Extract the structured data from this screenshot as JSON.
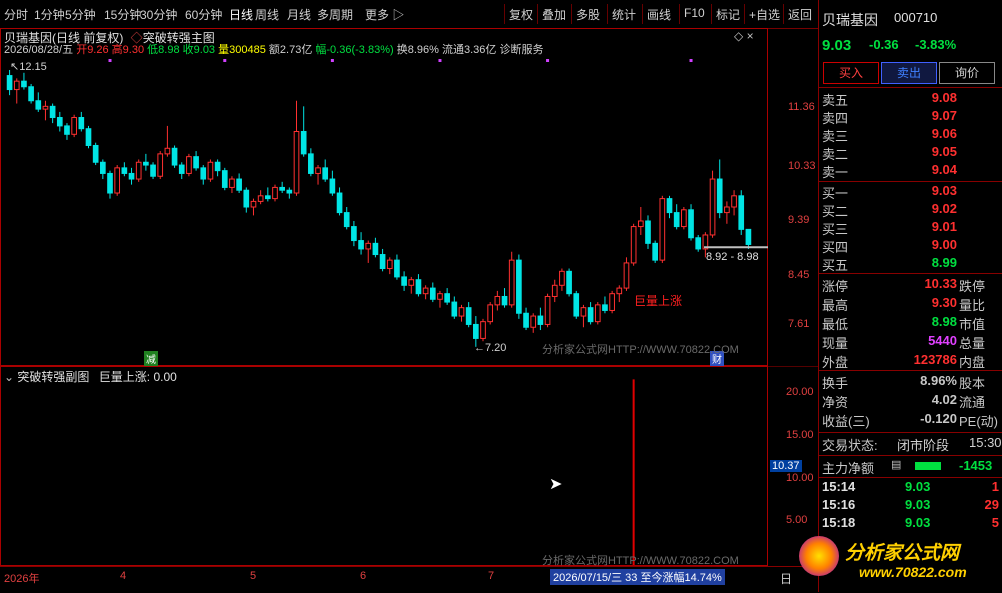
{
  "toolbar": {
    "items": [
      "分时",
      "1分钟",
      "5分钟",
      "15分钟",
      "30分钟",
      "60分钟",
      "日线",
      "周线",
      "月线",
      "多周期",
      "更多 ▷"
    ],
    "right_items": [
      "复权",
      "叠加",
      "多股",
      "统计",
      "画线",
      "F10",
      "标记",
      "+自选",
      "返回"
    ]
  },
  "main": {
    "title": "贝瑞基因(日线 前复权)",
    "indicator": "突破转强主图",
    "info": {
      "date": "2026/08/28/五",
      "open_label": "开",
      "open": "9.26",
      "high_label": "高",
      "high": "9.30",
      "low_label": "低",
      "low": "8.98",
      "close_label": "收",
      "close": "9.03",
      "volume_label": "量",
      "volume": "300485",
      "amount_label": "额",
      "amount": "2.73亿",
      "change_label": "幅",
      "change": "-0.36(-3.83%)",
      "turnover_label": "换",
      "turnover": "8.96%",
      "float_label": "流通",
      "float": "3.36亿",
      "service": "诊断服务"
    },
    "y_axis": [
      "11.36",
      "10.33",
      "9.39",
      "8.45",
      "7.61"
    ],
    "annotations": {
      "high_mark": "12.15",
      "low_mark": "←7.20",
      "range_label": "8.92 - 8.98",
      "signal_label": "巨量上涨",
      "minus_badge": "减",
      "fin_badge": "财",
      "site_text": "分析家公式网HTTP://WWW.70822.COM"
    }
  },
  "sub": {
    "title": "突破转强副图",
    "signal_label": "巨量上涨:",
    "signal_value": "0.00",
    "y_axis": [
      "20.00",
      "15.00",
      "10.00",
      "5.00"
    ],
    "cursor_value": "10.37"
  },
  "bottom": {
    "months": [
      "2026年",
      "4",
      "5",
      "6",
      "7"
    ],
    "range_info": "2026/07/15/三  33 至今涨幅14.74%",
    "right_label": "日"
  },
  "panel": {
    "name": "贝瑞基因",
    "code": "000710",
    "price": "9.03",
    "change": "-0.36",
    "change_pct": "-3.83%",
    "buttons": [
      "买入",
      "卖出",
      "询价"
    ],
    "sells": [
      {
        "label": "卖五",
        "price": "9.08"
      },
      {
        "label": "卖四",
        "price": "9.07"
      },
      {
        "label": "卖三",
        "price": "9.06"
      },
      {
        "label": "卖二",
        "price": "9.05"
      },
      {
        "label": "卖一",
        "price": "9.04"
      }
    ],
    "buys": [
      {
        "label": "买一",
        "price": "9.03"
      },
      {
        "label": "买二",
        "price": "9.02"
      },
      {
        "label": "买三",
        "price": "9.01"
      },
      {
        "label": "买四",
        "price": "9.00"
      },
      {
        "label": "买五",
        "price": "8.99"
      }
    ],
    "stats": [
      {
        "label": "涨停",
        "value": "10.33",
        "cls": "up",
        "right": "跌停"
      },
      {
        "label": "最高",
        "value": "9.30",
        "cls": "up",
        "right": "量比"
      },
      {
        "label": "最低",
        "value": "8.98",
        "cls": "down",
        "right": "市值"
      },
      {
        "label": "现量",
        "value": "5440",
        "cls": "purple",
        "right": "总量"
      },
      {
        "label": "外盘",
        "value": "123786",
        "cls": "up",
        "right": "内盘"
      }
    ],
    "stats2": [
      {
        "label": "换手",
        "value": "8.96%",
        "cls": "flat",
        "right": "股本"
      },
      {
        "label": "净资",
        "value": "4.02",
        "cls": "flat",
        "right": "流通"
      },
      {
        "label": "收益(三)",
        "value": "-0.120",
        "cls": "flat",
        "right": "PE(动)"
      }
    ],
    "trade_status_label": "交易状态:",
    "trade_status": "闭市阶段",
    "trade_time": "15:30",
    "main_flow_label": "主力净额",
    "main_flow_value": "-1453",
    "ticks": [
      {
        "time": "15:14",
        "price": "9.03",
        "vol": "1"
      },
      {
        "time": "15:16",
        "price": "9.03",
        "vol": "29"
      },
      {
        "time": "15:18",
        "price": "9.03",
        "vol": "5"
      }
    ],
    "logo_text": "分析家公式网",
    "logo_url": "www.70822.com"
  },
  "chart_data": {
    "type": "candlestick",
    "ylim": [
      7.0,
      12.4
    ],
    "candles": [
      [
        12.05,
        12.15,
        11.7,
        11.8
      ],
      [
        11.8,
        12.0,
        11.55,
        11.95
      ],
      [
        11.95,
        12.1,
        11.8,
        11.85
      ],
      [
        11.85,
        11.9,
        11.55,
        11.6
      ],
      [
        11.6,
        11.75,
        11.4,
        11.45
      ],
      [
        11.45,
        11.6,
        11.25,
        11.5
      ],
      [
        11.5,
        11.55,
        11.2,
        11.3
      ],
      [
        11.3,
        11.4,
        11.05,
        11.15
      ],
      [
        11.15,
        11.2,
        10.9,
        11.0
      ],
      [
        11.0,
        11.35,
        10.95,
        11.3
      ],
      [
        11.3,
        11.4,
        11.05,
        11.1
      ],
      [
        11.1,
        11.15,
        10.75,
        10.8
      ],
      [
        10.8,
        10.85,
        10.45,
        10.5
      ],
      [
        10.5,
        10.55,
        10.2,
        10.3
      ],
      [
        10.3,
        10.35,
        9.85,
        9.95
      ],
      [
        9.95,
        10.45,
        9.9,
        10.4
      ],
      [
        10.4,
        10.5,
        10.25,
        10.3
      ],
      [
        10.3,
        10.4,
        10.1,
        10.2
      ],
      [
        10.2,
        10.55,
        10.15,
        10.5
      ],
      [
        10.5,
        10.65,
        10.35,
        10.45
      ],
      [
        10.45,
        10.5,
        10.2,
        10.25
      ],
      [
        10.25,
        10.7,
        10.2,
        10.65
      ],
      [
        10.65,
        11.15,
        10.6,
        10.75
      ],
      [
        10.75,
        10.8,
        10.4,
        10.45
      ],
      [
        10.45,
        10.5,
        10.2,
        10.3
      ],
      [
        10.3,
        10.65,
        10.25,
        10.6
      ],
      [
        10.6,
        10.7,
        10.35,
        10.4
      ],
      [
        10.4,
        10.45,
        10.1,
        10.2
      ],
      [
        10.2,
        10.55,
        10.15,
        10.5
      ],
      [
        10.5,
        10.55,
        10.25,
        10.35
      ],
      [
        10.35,
        10.4,
        10.0,
        10.05
      ],
      [
        10.05,
        10.25,
        9.95,
        10.2
      ],
      [
        10.2,
        10.3,
        9.95,
        10.0
      ],
      [
        10.0,
        10.05,
        9.6,
        9.7
      ],
      [
        9.7,
        9.85,
        9.55,
        9.8
      ],
      [
        9.8,
        10.0,
        9.75,
        9.9
      ],
      [
        9.9,
        10.05,
        9.8,
        9.85
      ],
      [
        9.85,
        10.1,
        9.8,
        10.05
      ],
      [
        10.05,
        10.15,
        9.95,
        10.0
      ],
      [
        10.0,
        10.05,
        9.85,
        9.95
      ],
      [
        9.95,
        11.6,
        9.9,
        11.05
      ],
      [
        11.05,
        11.5,
        10.6,
        10.65
      ],
      [
        10.65,
        10.75,
        10.25,
        10.3
      ],
      [
        10.3,
        10.45,
        10.1,
        10.4
      ],
      [
        10.4,
        10.55,
        10.15,
        10.2
      ],
      [
        10.2,
        10.35,
        9.9,
        9.95
      ],
      [
        9.95,
        10.05,
        9.55,
        9.6
      ],
      [
        9.6,
        9.7,
        9.3,
        9.35
      ],
      [
        9.35,
        9.45,
        9.0,
        9.1
      ],
      [
        9.1,
        9.25,
        8.85,
        8.95
      ],
      [
        8.95,
        9.1,
        8.7,
        9.05
      ],
      [
        9.05,
        9.15,
        8.8,
        8.85
      ],
      [
        8.85,
        8.95,
        8.55,
        8.6
      ],
      [
        8.6,
        8.8,
        8.5,
        8.75
      ],
      [
        8.75,
        8.85,
        8.4,
        8.45
      ],
      [
        8.45,
        8.55,
        8.2,
        8.3
      ],
      [
        8.3,
        8.45,
        8.15,
        8.4
      ],
      [
        8.4,
        8.5,
        8.1,
        8.15
      ],
      [
        8.15,
        8.3,
        8.05,
        8.25
      ],
      [
        8.25,
        8.35,
        8.0,
        8.05
      ],
      [
        8.05,
        8.2,
        7.9,
        8.15
      ],
      [
        8.15,
        8.25,
        7.95,
        8.0
      ],
      [
        8.0,
        8.1,
        7.7,
        7.75
      ],
      [
        7.75,
        7.95,
        7.65,
        7.9
      ],
      [
        7.9,
        8.0,
        7.55,
        7.6
      ],
      [
        7.6,
        7.75,
        7.2,
        7.35
      ],
      [
        7.35,
        7.7,
        7.3,
        7.65
      ],
      [
        7.65,
        8.0,
        7.6,
        7.95
      ],
      [
        7.95,
        8.2,
        7.85,
        8.1
      ],
      [
        8.1,
        8.25,
        7.9,
        7.95
      ],
      [
        7.95,
        8.9,
        7.9,
        8.75
      ],
      [
        8.75,
        8.85,
        7.7,
        7.8
      ],
      [
        7.8,
        7.9,
        7.5,
        7.55
      ],
      [
        7.55,
        7.8,
        7.45,
        7.75
      ],
      [
        7.75,
        7.9,
        7.5,
        7.6
      ],
      [
        7.6,
        8.15,
        7.55,
        8.1
      ],
      [
        8.1,
        8.4,
        8.0,
        8.3
      ],
      [
        8.3,
        8.6,
        8.2,
        8.55
      ],
      [
        8.55,
        8.6,
        8.1,
        8.15
      ],
      [
        8.15,
        8.2,
        7.7,
        7.75
      ],
      [
        7.75,
        7.95,
        7.55,
        7.9
      ],
      [
        7.9,
        8.0,
        7.6,
        7.65
      ],
      [
        7.65,
        8.0,
        7.6,
        7.95
      ],
      [
        7.95,
        8.1,
        7.8,
        7.85
      ],
      [
        7.85,
        8.2,
        7.8,
        8.15
      ],
      [
        8.15,
        8.3,
        8.0,
        8.25
      ],
      [
        8.25,
        8.8,
        8.2,
        8.7
      ],
      [
        8.7,
        9.4,
        8.65,
        9.35
      ],
      [
        9.35,
        9.7,
        9.2,
        9.45
      ],
      [
        9.45,
        9.55,
        8.95,
        9.05
      ],
      [
        9.05,
        9.1,
        8.7,
        8.75
      ],
      [
        8.75,
        9.9,
        8.7,
        9.85
      ],
      [
        9.85,
        9.9,
        9.5,
        9.6
      ],
      [
        9.6,
        9.75,
        9.3,
        9.35
      ],
      [
        9.35,
        9.7,
        9.3,
        9.65
      ],
      [
        9.65,
        9.75,
        9.1,
        9.15
      ],
      [
        9.15,
        9.2,
        8.9,
        8.95
      ],
      [
        8.95,
        9.25,
        8.8,
        9.2
      ],
      [
        9.2,
        10.35,
        9.15,
        10.2
      ],
      [
        10.2,
        10.55,
        9.5,
        9.6
      ],
      [
        9.6,
        9.8,
        9.4,
        9.7
      ],
      [
        9.7,
        10.0,
        9.55,
        9.9
      ],
      [
        9.9,
        10.0,
        9.2,
        9.3
      ],
      [
        9.3,
        9.3,
        8.95,
        9.03
      ]
    ],
    "sub_series": [
      {
        "name": "巨量上涨",
        "spike_index": 87,
        "spike_value": 22.0
      }
    ]
  }
}
